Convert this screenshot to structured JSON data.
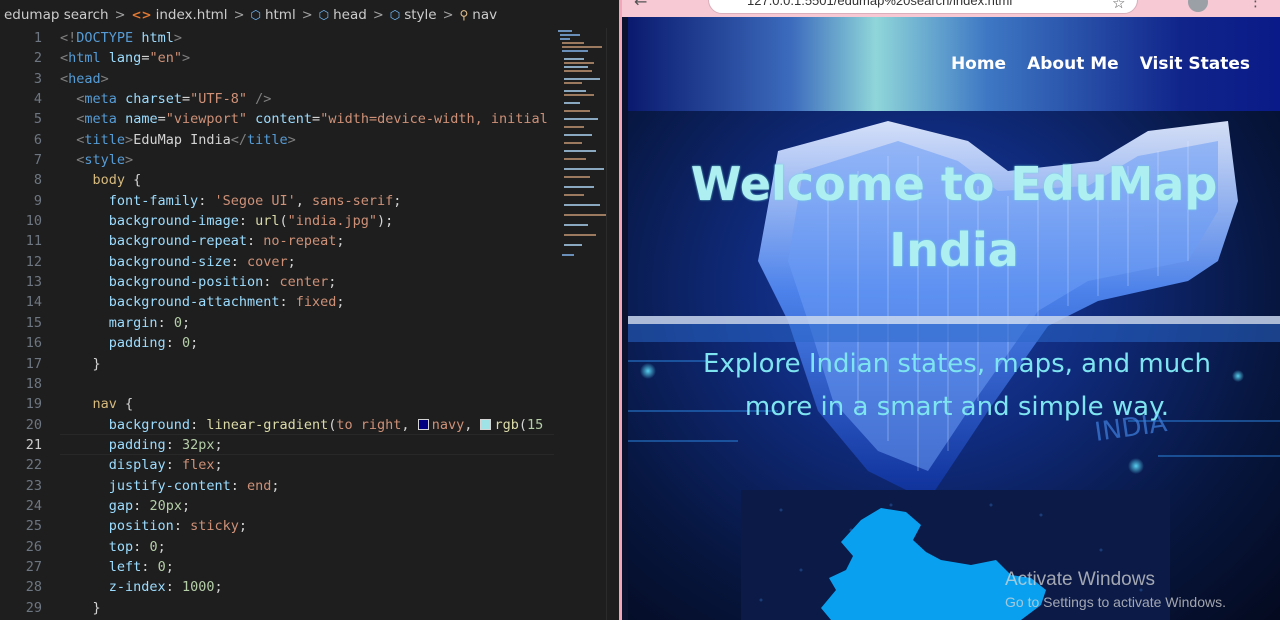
{
  "editor": {
    "breadcrumb": [
      {
        "label": "edumap search",
        "icon": "folder"
      },
      {
        "label": "index.html",
        "icon": "html-file-icon"
      },
      {
        "label": "html",
        "icon": "cube-icon"
      },
      {
        "label": "head",
        "icon": "cube-icon"
      },
      {
        "label": "style",
        "icon": "cube-icon"
      },
      {
        "label": "nav",
        "icon": "selector-icon"
      }
    ],
    "active_line": 21,
    "line_numbers": [
      "1",
      "2",
      "3",
      "4",
      "5",
      "6",
      "7",
      "8",
      "9",
      "10",
      "11",
      "12",
      "13",
      "14",
      "15",
      "16",
      "17",
      "18",
      "19",
      "20",
      "21",
      "22",
      "23",
      "24",
      "25",
      "26",
      "27",
      "28",
      "29"
    ]
  },
  "browser": {
    "url": "127.0.0.1:5501/edumap%20search/index.html",
    "nav_links": [
      "Home",
      "About Me",
      "Visit States"
    ],
    "hero_title": "Welcome to EduMap India",
    "hero_subtitle": "Explore Indian states, maps, and much more in a smart and simple way.",
    "hero_art_text": "INDIA"
  },
  "watermark": {
    "title": "Activate Windows",
    "subtitle": "Go to Settings to activate Windows."
  },
  "colors": {
    "nav_gradient_start": "#000080",
    "nav_gradient_mid": "#8fd6d9",
    "swatch_navy": "#000080",
    "swatch_aqua": "#9fe3e6",
    "hero_title": "#aef0f2",
    "hero_subtitle": "#7ee4f0"
  }
}
